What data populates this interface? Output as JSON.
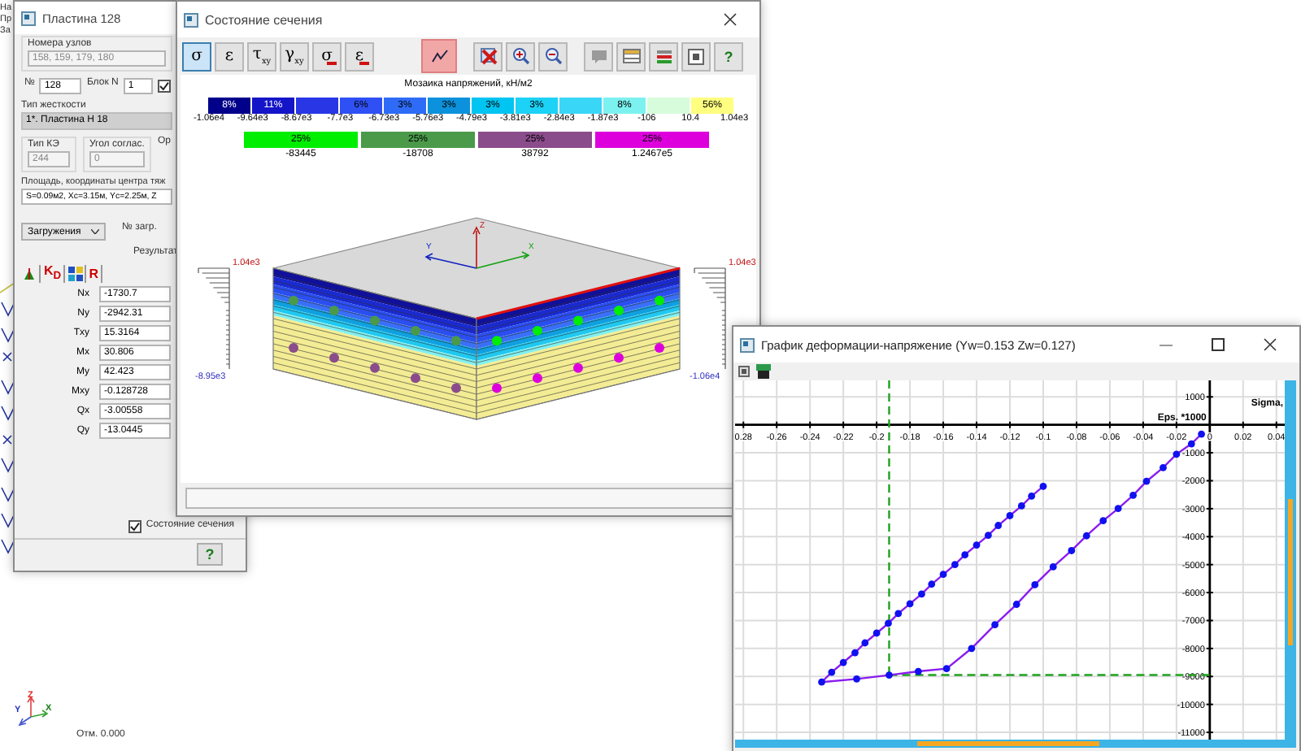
{
  "desktop": {
    "edge_labels": [
      "На",
      "Пр",
      "За"
    ],
    "axis_labels": [
      "Z",
      "Y",
      "X"
    ],
    "elevation": "Отм. 0.000"
  },
  "plate_window": {
    "title": "Пластина 128",
    "nodes_label": "Номера узлов",
    "nodes": "158, 159, 179, 180",
    "number_label": "№",
    "number": "128",
    "block_label": "Блок N",
    "block": "1",
    "block_checked": true,
    "stiffness_label": "Тип жесткости",
    "stiffness": "1*. Пластина  Н 18",
    "fe_type_label": "Тип КЭ",
    "fe_type": "244",
    "angle_label": "Угол соглас.",
    "angle": "0",
    "orient_label": "Ор",
    "area_label": "Площадь, координаты центра тяж",
    "area": "S=0.09м2, Xc=3.15м, Yc=2.25м, Z",
    "loads_dropdown": "Загружения",
    "load_no_label": "№ загр.",
    "result_label": "Результат",
    "result_tools": [
      {
        "kind": "arrow"
      },
      {
        "kind": "text",
        "label": "K$_{D}$"
      },
      {
        "kind": "grid"
      },
      {
        "kind": "text",
        "label": "R"
      }
    ],
    "results": [
      {
        "name": "Nx",
        "value": "-1730.7"
      },
      {
        "name": "Ny",
        "value": "-2942.31"
      },
      {
        "name": "Txy",
        "value": "15.3164"
      },
      {
        "name": "Mx",
        "value": "30.806"
      },
      {
        "name": "My",
        "value": "42.423"
      },
      {
        "name": "Mxy",
        "value": "-0.128728"
      },
      {
        "name": "Qx",
        "value": "-3.00558"
      },
      {
        "name": "Qy",
        "value": "-13.0445"
      }
    ],
    "section_state": {
      "label": "Состояние сечения",
      "checked": true
    },
    "help": "?"
  },
  "section_window": {
    "title": "Состояние сечения",
    "tools": [
      {
        "label": "σ",
        "kind": "plain",
        "selected": true
      },
      {
        "label": "ε",
        "kind": "plain",
        "selected": false
      },
      {
        "label": "τ$_{xy}$",
        "kind": "plain",
        "selected": false
      },
      {
        "label": "γ$_{xy}$",
        "kind": "plain",
        "selected": false
      },
      {
        "label": "σ",
        "kind": "limit",
        "selected": false
      },
      {
        "label": "ε",
        "kind": "limit",
        "selected": false
      }
    ],
    "action_groups": [
      [
        {
          "kind": "chart",
          "selected": true
        }
      ],
      [
        {
          "kind": "cross",
          "selected": false
        },
        {
          "kind": "zoom-in",
          "selected": false
        },
        {
          "kind": "zoom-out",
          "selected": false
        }
      ],
      [
        {
          "kind": "note",
          "selected": false
        },
        {
          "kind": "table",
          "selected": false
        },
        {
          "kind": "layers",
          "selected": false
        },
        {
          "kind": "frame",
          "selected": false
        },
        {
          "kind": "help",
          "label": "?",
          "selected": false
        }
      ]
    ],
    "mosaic_title": "Мозаика напряжений, кН/м2",
    "stress_bins": [
      {
        "color": "#00008b",
        "percent": "8%"
      },
      {
        "color": "#1414c8",
        "percent": "11%"
      },
      {
        "color": "#2836e6"
      },
      {
        "color": "#2f50f5",
        "percent": "6%"
      },
      {
        "color": "#2e6cf8",
        "percent": "3%"
      },
      {
        "color": "#0c92dc",
        "percent": "3%"
      },
      {
        "color": "#00c4f2",
        "percent": "3%"
      },
      {
        "color": "#1cd2f6",
        "percent": "3%"
      },
      {
        "color": "#3ad6f8"
      },
      {
        "color": "#7cf2f0",
        "percent": "8%"
      },
      {
        "color": "#d6fcdc"
      },
      {
        "color": "#ffff80",
        "percent": "56%"
      }
    ],
    "stress_bounds": [
      "-1.06e4",
      "-9.64e3",
      "-8.67e3",
      "-7.7e3",
      "-6.73e3",
      "-5.76e3",
      "-4.79e3",
      "-3.81e3",
      "-2.84e3",
      "-1.87e3",
      "-106",
      "10.4",
      "1.04e3"
    ],
    "group_bins": [
      {
        "color": "#00ee00",
        "percent": "25%",
        "value": "-83445"
      },
      {
        "color": "#4a9a4a",
        "percent": "25%",
        "value": "-18708"
      },
      {
        "color": "#8b4c8b",
        "percent": "25%",
        "value": "38792"
      },
      {
        "color": "#dd00dd",
        "percent": "25%",
        "value": "1.2467e5"
      }
    ],
    "drawing": {
      "top_left": "1.04e3",
      "top_right": "1.04e3",
      "bottom_left": "-8.95e3",
      "bottom_right": "-1.06e4",
      "axes": [
        "Z",
        "Y",
        "X"
      ]
    }
  },
  "chart_window": {
    "title": "График деформации-напряжение (Yw=0.153 Zw=0.127)",
    "chart_data": {
      "type": "line",
      "xlabel": "Eps. *1000",
      "ylabel": "Sigma,",
      "xlim": [
        -0.285,
        0.045
      ],
      "ylim": [
        -11260,
        1590
      ],
      "xticks": [
        {
          "value": -0.28,
          "label": "0.28"
        },
        -0.26,
        -0.24,
        -0.22,
        -0.2,
        -0.18,
        -0.16,
        -0.14,
        -0.12,
        -0.1,
        -0.08,
        -0.06,
        -0.04,
        -0.02,
        0,
        0.02,
        0.04
      ],
      "yticks": [
        1000,
        -1000,
        -2000,
        -3000,
        -4000,
        -5000,
        -6000,
        -7000,
        -8000,
        -9000,
        -10000,
        -11000
      ],
      "x": [
        -0.1,
        -0.107,
        -0.113,
        -0.12,
        -0.127,
        -0.133,
        -0.14,
        -0.147,
        -0.153,
        -0.16,
        -0.167,
        -0.173,
        -0.18,
        -0.187,
        -0.193,
        -0.2,
        -0.207,
        -0.213,
        -0.22,
        -0.227,
        -0.233,
        -0.212,
        -0.1925,
        -0.175,
        -0.158,
        -0.143,
        -0.129,
        -0.116,
        -0.105,
        -0.094,
        -0.083,
        -0.074,
        -0.064,
        -0.055,
        -0.046,
        -0.038,
        -0.028,
        -0.02,
        -0.011,
        -0.005
      ],
      "grid": true,
      "series": [
        {
          "color": "#8a1cf0",
          "marker": "circle",
          "values": [
            -2200,
            -2550,
            -2900,
            -3250,
            -3600,
            -3950,
            -4300,
            -4650,
            -5000,
            -5350,
            -5700,
            -6050,
            -6400,
            -6750,
            -7100,
            -7450,
            -7800,
            -8150,
            -8500,
            -8850,
            -9200,
            -9090,
            -8950,
            -8820,
            -8720,
            -8000,
            -7150,
            -6420,
            -5720,
            -5080,
            -4500,
            -3970,
            -3430,
            -2990,
            -2520,
            -2020,
            -1530,
            -1050,
            -680,
            -330
          ]
        }
      ],
      "ref_lines": [
        {
          "axis": "x",
          "value": -0.1925,
          "color": "#20a020"
        },
        {
          "axis": "y",
          "value": -8950,
          "color": "#20a020"
        }
      ]
    }
  }
}
